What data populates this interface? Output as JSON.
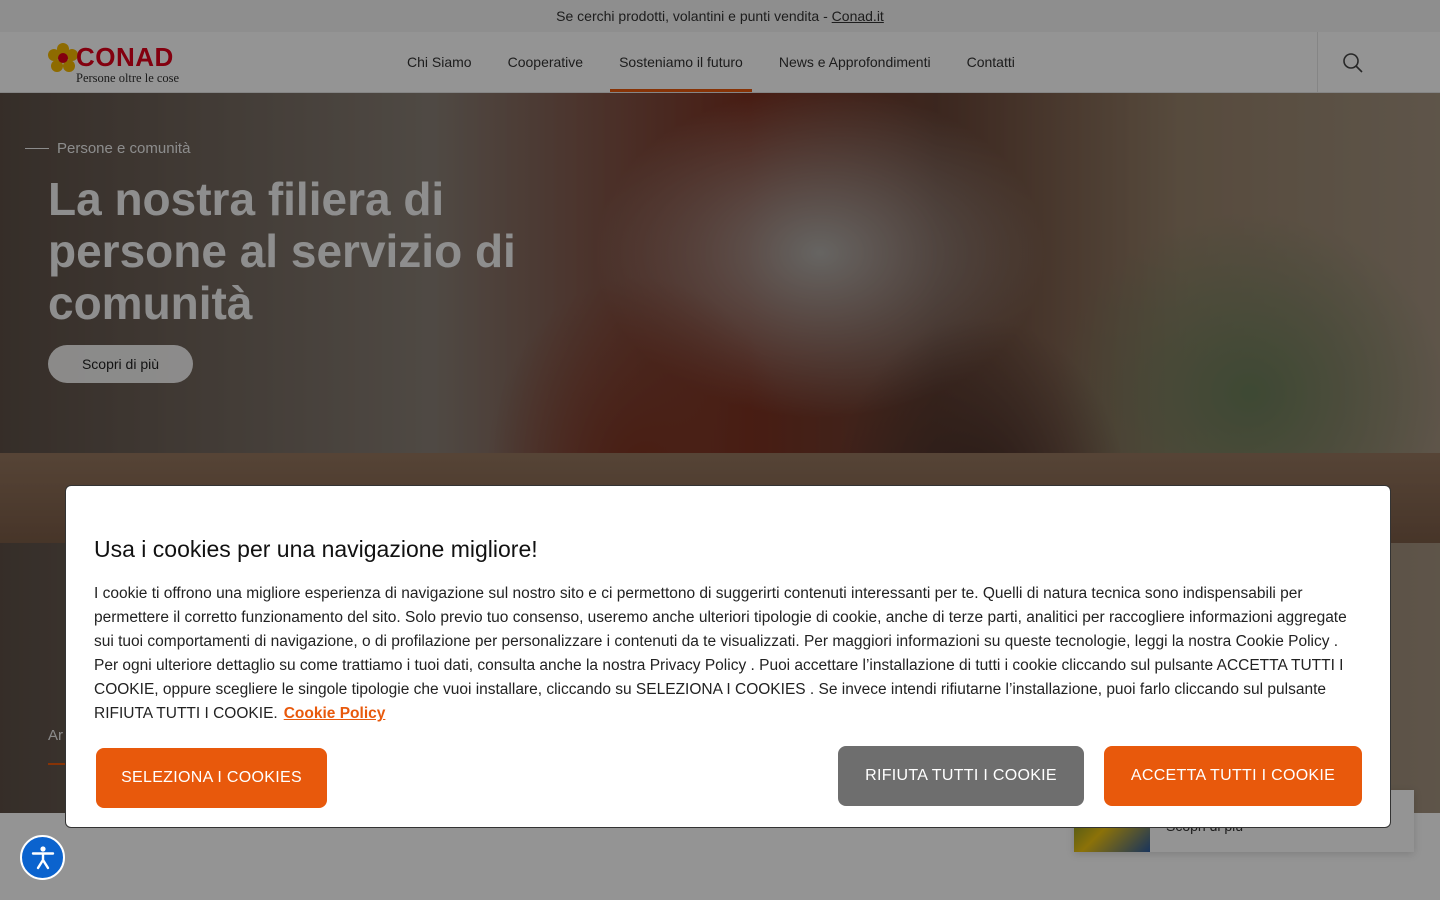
{
  "topbar": {
    "text": "Se cerchi prodotti, volantini e punti vendita - ",
    "link": "Conad.it"
  },
  "header": {
    "logo": {
      "brand": "CONAD",
      "tagline": "Persone oltre le cose"
    },
    "nav": [
      "Chi Siamo",
      "Cooperative",
      "Sosteniamo il futuro",
      "News e Approfondimenti",
      "Contatti"
    ],
    "active_nav": "Sosteniamo il futuro"
  },
  "hero": {
    "kicker": "Persone e comunità",
    "title": "La nostra filiera di persone al servizio di comunità",
    "cta": "Scopri di più",
    "tab_label": "Ar"
  },
  "card": {
    "label": "Scopri di più"
  },
  "cookie": {
    "title": "Usa i cookies per una navigazione migliore!",
    "body": "I cookie ti offrono una migliore esperienza di navigazione sul nostro sito e ci permettono di suggerirti contenuti interessanti per te. Quelli di natura tecnica sono indispensabili per permettere il corretto funzionamento del sito. Solo previo tuo consenso, useremo anche ulteriori tipologie di cookie, anche di terze parti, analitici per raccogliere informazioni aggregate sui tuoi comportamenti di navigazione, o di profilazione per personalizzare i contenuti da te visualizzati. Per maggiori informazioni su queste tecnologie, leggi la nostra Cookie Policy . Per ogni ulteriore dettaglio su come trattiamo i tuoi dati, consulta anche la nostra Privacy Policy . Puoi accettare l’installazione di tutti i cookie cliccando sul pulsante ACCETTA TUTTI I COOKIE, oppure scegliere le singole tipologie che vuoi installare, cliccando su SELEZIONA I COOKIES . Se invece intendi rifiutarne l’installazione, puoi farlo cliccando sul pulsante RIFIUTA TUTTI I COOKIE.",
    "policy_link": "Cookie Policy",
    "buttons": {
      "select": "SELEZIONA I COOKIES",
      "reject": "RIFIUTA TUTTI I COOKIE",
      "accept": "ACCETTA TUTTI I COOKIE"
    }
  },
  "colors": {
    "accent": "#e8590c",
    "reject": "#6e6e6e",
    "brand_red": "#e2001a",
    "accessibility": "#0b63ce"
  },
  "icons": [
    "conad-flower-logo",
    "search-icon",
    "accessibility-icon"
  ]
}
